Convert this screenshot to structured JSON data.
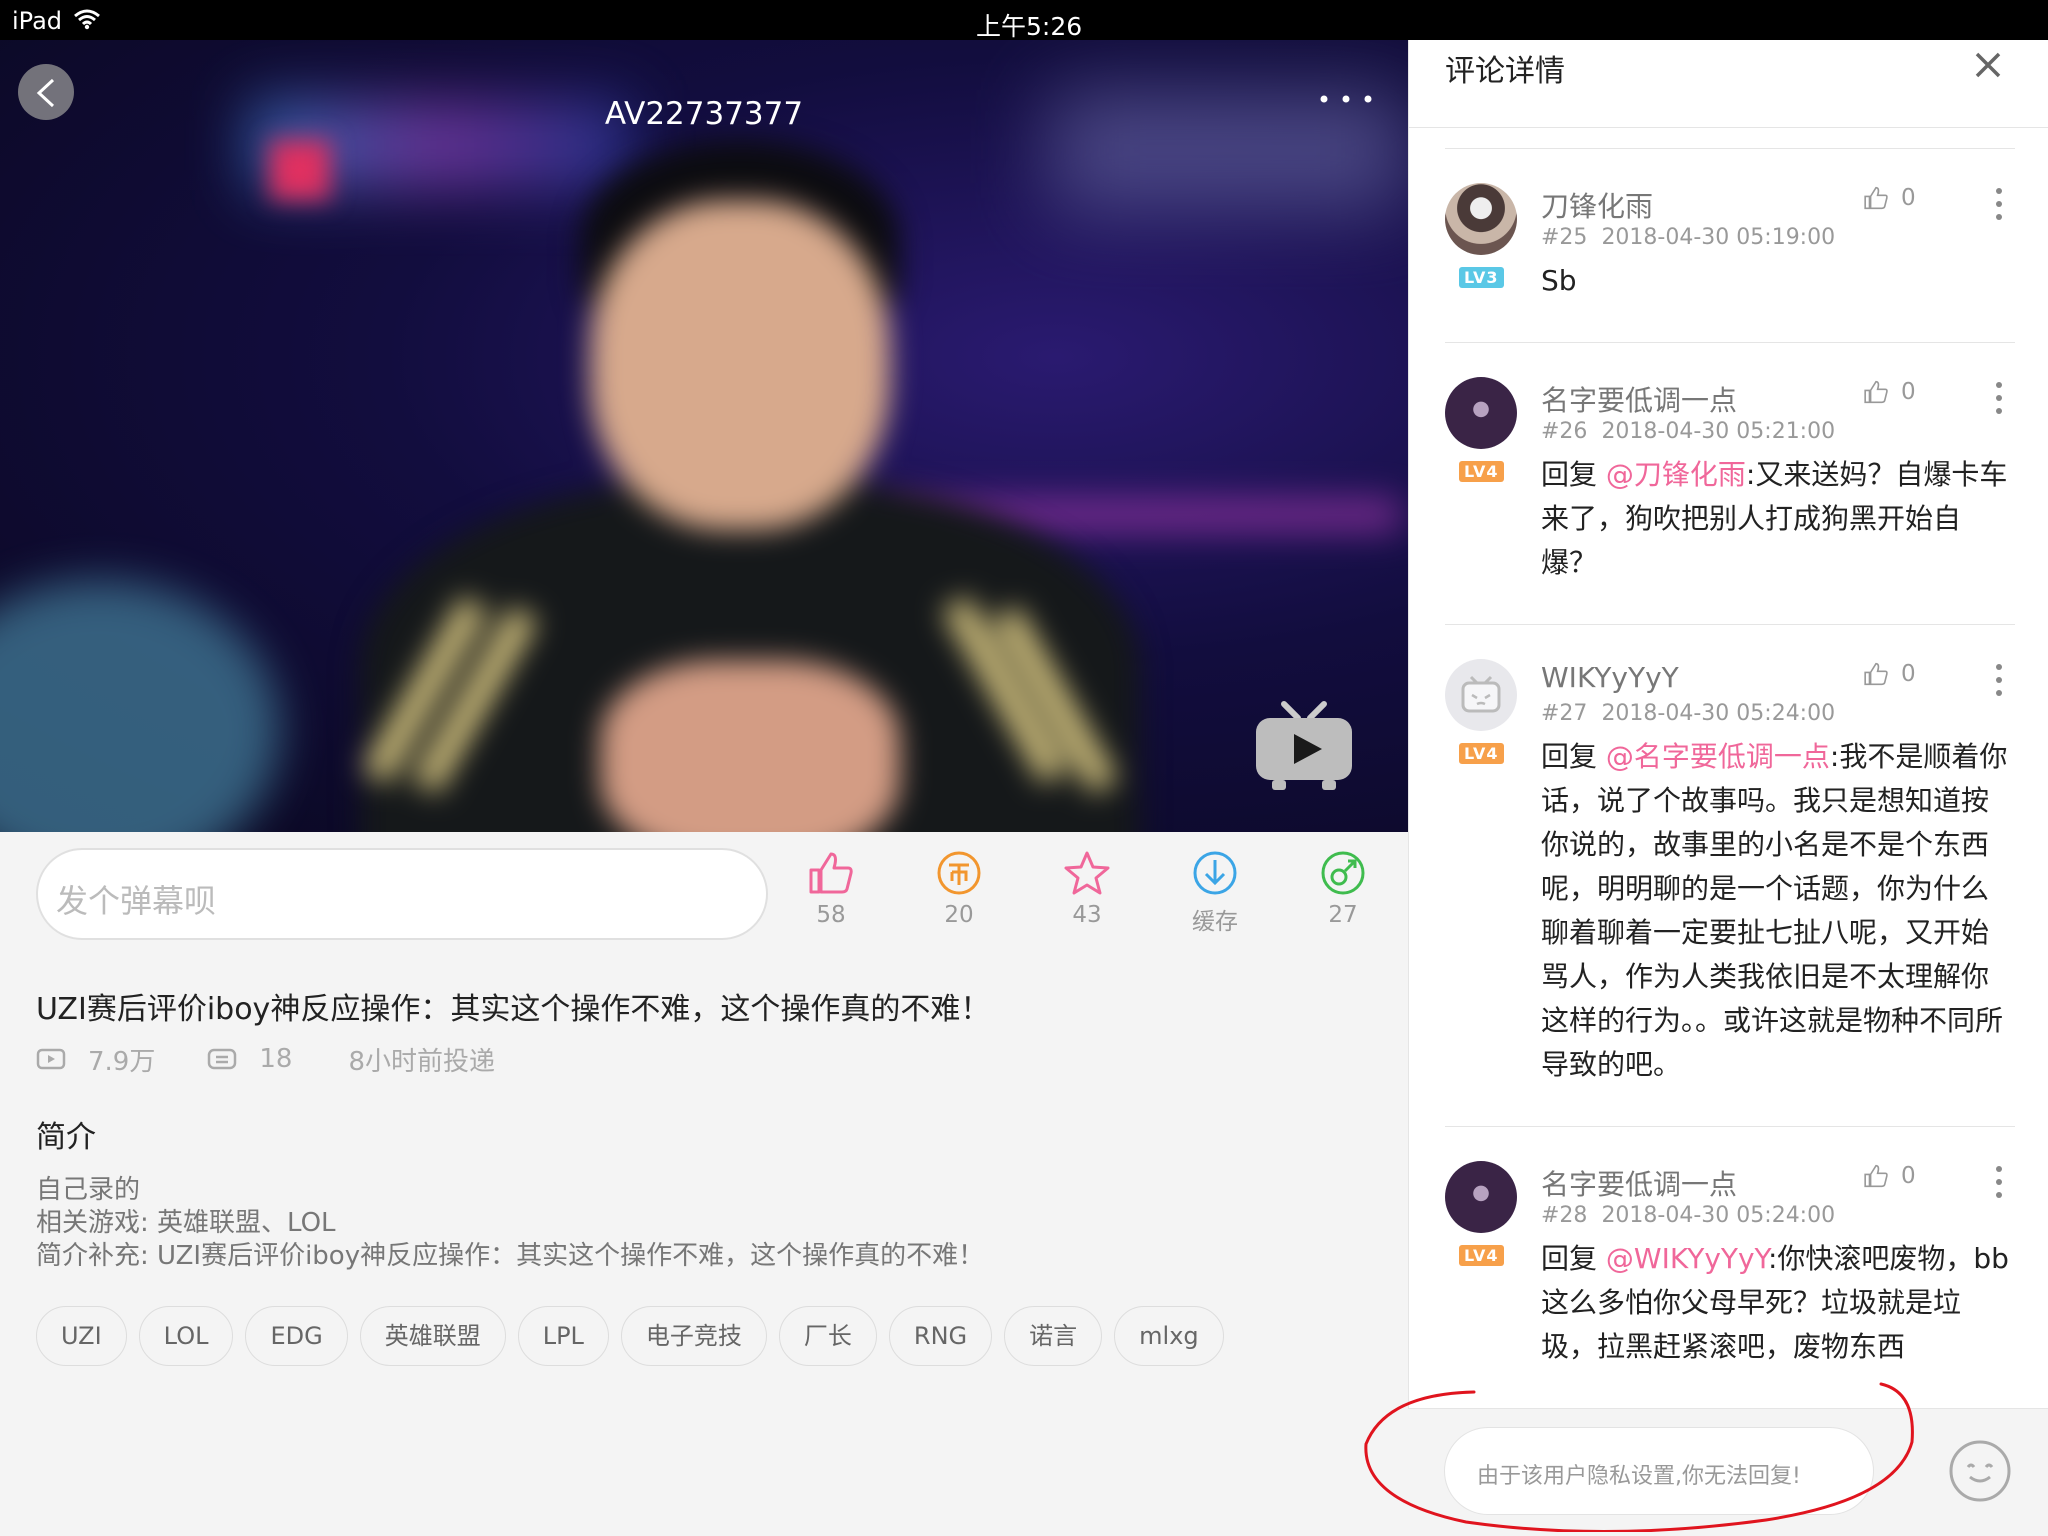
{
  "status_bar": {
    "device": "iPad",
    "time": "上午5:26"
  },
  "video": {
    "title": "AV22737377"
  },
  "danmaku_placeholder": "发个弹幕呗",
  "actions": [
    {
      "name": "like",
      "value": "58",
      "color": "#f0679a"
    },
    {
      "name": "coin",
      "value": "20",
      "color": "#f2962e"
    },
    {
      "name": "favorite",
      "value": "43",
      "color": "#f0679a"
    },
    {
      "name": "cache",
      "value": "缓存",
      "color": "#3ba5e6"
    },
    {
      "name": "share",
      "value": "27",
      "color": "#3fbc4e"
    }
  ],
  "info": {
    "title": "UZI赛后评价iboy神反应操作：其实这个操作不难，这个操作真的不难！",
    "views": "7.9万",
    "danmaku_count": "18",
    "posted": "8小时前投递",
    "intro_heading": "简介",
    "intro_lines": [
      "自己录的",
      "相关游戏: 英雄联盟、LOL",
      "简介补充: UZI赛后评价iboy神反应操作：其实这个操作不难，这个操作真的不难！"
    ],
    "tags": [
      "UZI",
      "LOL",
      "EDG",
      "英雄联盟",
      "LPL",
      "电子竞技",
      "厂长",
      "RNG",
      "诺言",
      "mlxg"
    ]
  },
  "panel": {
    "title": "评论详情",
    "comments": [
      {
        "user": "刀锋化雨",
        "level": "LV3",
        "level_color": "#5ac8e6",
        "floor": "#25",
        "time": "2018-04-30 05:19:00",
        "likes": "0",
        "prefix": "",
        "mention": "",
        "text": "Sb"
      },
      {
        "user": "名字要低调一点",
        "level": "LV4",
        "level_color": "#f7a04a",
        "floor": "#26",
        "time": "2018-04-30 05:21:00",
        "likes": "0",
        "prefix": "回复 ",
        "mention": "@刀锋化雨",
        "text": ":又来送妈？自爆卡车来了，狗吹把别人打成狗黑开始自爆？"
      },
      {
        "user": "WIKYyYyY",
        "level": "LV4",
        "level_color": "#f7a04a",
        "floor": "#27",
        "time": "2018-04-30 05:24:00",
        "likes": "0",
        "prefix": "回复 ",
        "mention": "@名字要低调一点",
        "text": ":我不是顺着你话，说了个故事吗。我只是想知道按你说的，故事里的小名是不是个东西呢，明明聊的是一个话题，你为什么聊着聊着一定要扯七扯八呢，又开始骂人，作为人类我依旧是不太理解你这样的行为。。或许这就是物种不同所导致的吧。"
      },
      {
        "user": "名字要低调一点",
        "level": "LV4",
        "level_color": "#f7a04a",
        "floor": "#28",
        "time": "2018-04-30 05:24:00",
        "likes": "0",
        "prefix": "回复 ",
        "mention": "@WIKYyYyY",
        "text": ":你快滚吧废物，bb这么多怕你父母早死？垃圾就是垃圾，拉黑赶紧滚吧，废物东西"
      }
    ],
    "reply_placeholder": "由于该用户隐私设置,你无法回复!"
  },
  "colors": {
    "accent": "#f0679a",
    "annotation": "#e0141e"
  }
}
